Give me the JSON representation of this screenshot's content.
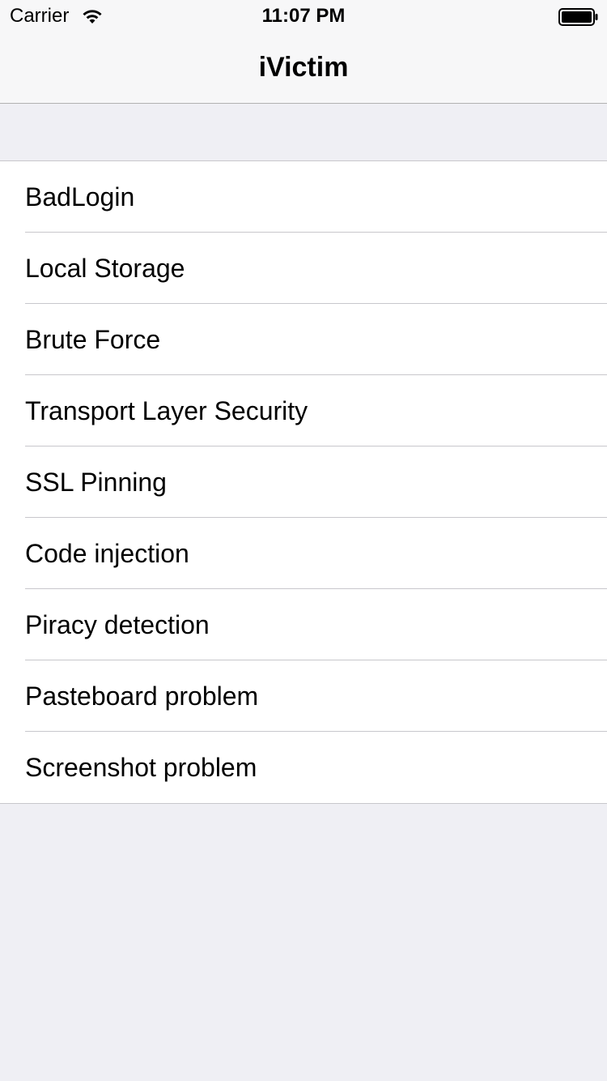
{
  "status_bar": {
    "carrier": "Carrier",
    "time": "11:07 PM",
    "wifi_icon": "wifi-icon",
    "battery_icon": "battery-icon"
  },
  "nav": {
    "title": "iVictim"
  },
  "menu": {
    "items": [
      {
        "label": "BadLogin"
      },
      {
        "label": "Local Storage"
      },
      {
        "label": "Brute Force"
      },
      {
        "label": "Transport Layer Security"
      },
      {
        "label": "SSL Pinning"
      },
      {
        "label": "Code injection"
      },
      {
        "label": "Piracy detection"
      },
      {
        "label": "Pasteboard problem"
      },
      {
        "label": "Screenshot problem"
      }
    ]
  },
  "colors": {
    "background": "#efeff4",
    "bar_background": "#f7f7f8",
    "separator": "#c8c7cc"
  }
}
